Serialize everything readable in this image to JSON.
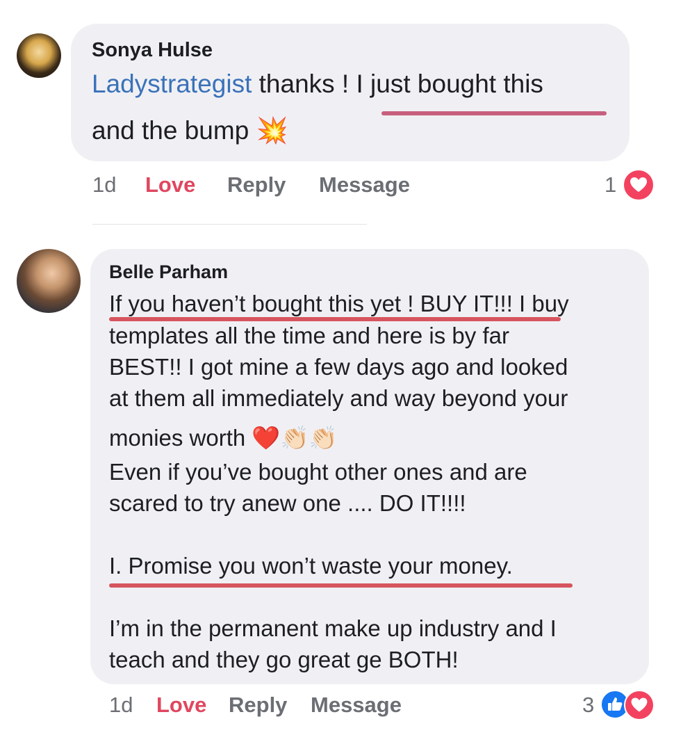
{
  "comments": [
    {
      "author": "Sonya Hulse",
      "mention": "Ladystrategist",
      "lines": [
        "thanks ! I just bought this",
        "and the bump",
        "💥"
      ],
      "time": "1d",
      "actions": {
        "love": "Love",
        "reply": "Reply",
        "message": "Message"
      },
      "reaction_count": "1",
      "reaction_icons": [
        "heart-icon"
      ]
    },
    {
      "author": "Belle Parham",
      "lines": [
        "If you haven’t bought this yet ! BUY IT!!!  I buy",
        "templates all the time and here is by far",
        "BEST!! I got mine a few days ago and looked",
        "at them all immediately and way beyond your",
        "monies worth",
        "❤️👏🏻👏🏻",
        "Even if you’ve bought other ones and are",
        "scared to try anew one .... DO IT!!!!",
        "I. Promise you won’t waste your money.",
        "I’m in the permanent make up industry and I",
        "teach and they go great ge BOTH!"
      ],
      "time": "1d",
      "actions": {
        "love": "Love",
        "reply": "Reply",
        "message": "Message"
      },
      "reaction_count": "3",
      "reaction_icons": [
        "like-icon",
        "heart-icon"
      ]
    }
  ],
  "colors": {
    "bubble": "#f0f0f4",
    "mention": "#3a72b9",
    "love": "#e0475f",
    "underline_pink": "#c85f7e",
    "underline_red": "#d6545e"
  }
}
